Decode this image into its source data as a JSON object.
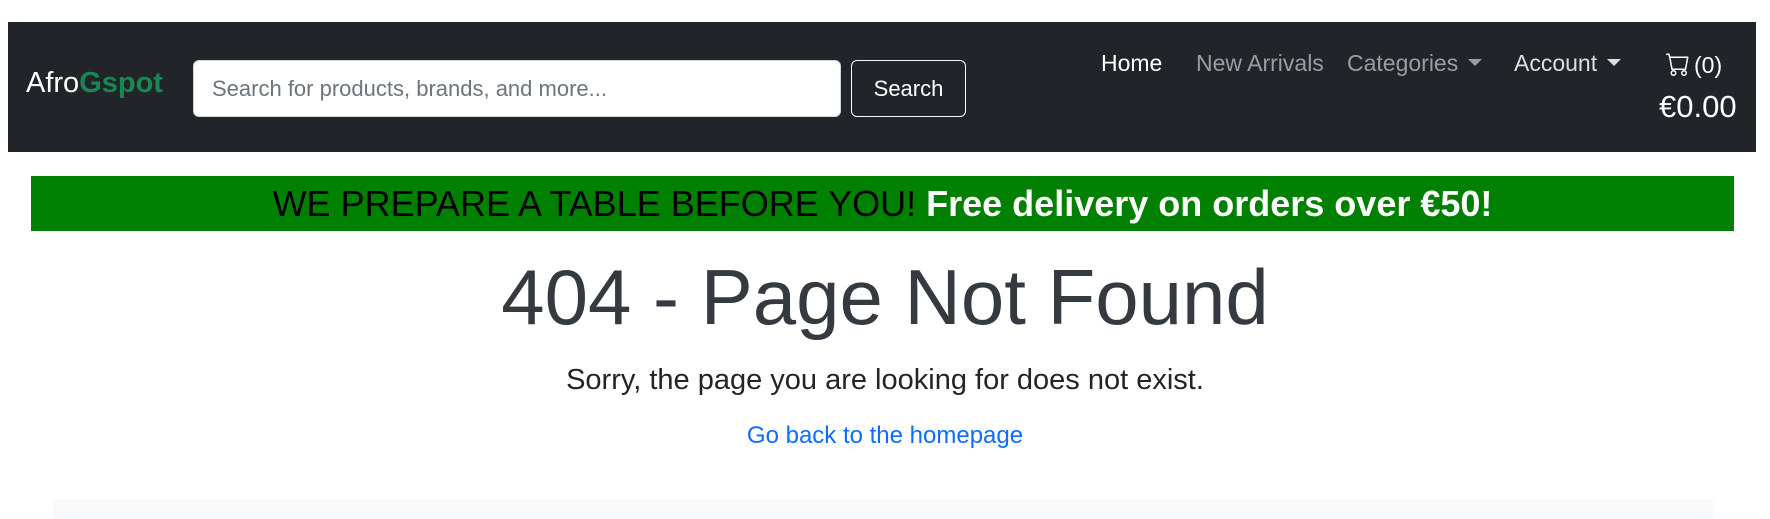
{
  "brand": {
    "part1": "Afro",
    "part2": "Gspot"
  },
  "search": {
    "placeholder": "Search for products, brands, and more...",
    "value": "",
    "button_label": "Search"
  },
  "nav": {
    "home": "Home",
    "new_arrivals": "New Arrivals",
    "categories": "Categories",
    "account": "Account"
  },
  "cart": {
    "count_label": "(0)",
    "total": "€0.00"
  },
  "banner": {
    "text1": "WE PREPARE A TABLE BEFORE YOU!",
    "text2": "Free delivery on orders over €50!"
  },
  "main": {
    "heading": "404 - Page Not Found",
    "message": "Sorry, the page you are looking for does not exist.",
    "home_link": "Go back to the homepage"
  },
  "colors": {
    "navbar_bg": "#212529",
    "brand_accent": "#198754",
    "banner_bg": "#008000",
    "link": "#0d6efd"
  },
  "icons": {
    "cart": "cart-icon",
    "dropdown": "caret-down-icon"
  }
}
